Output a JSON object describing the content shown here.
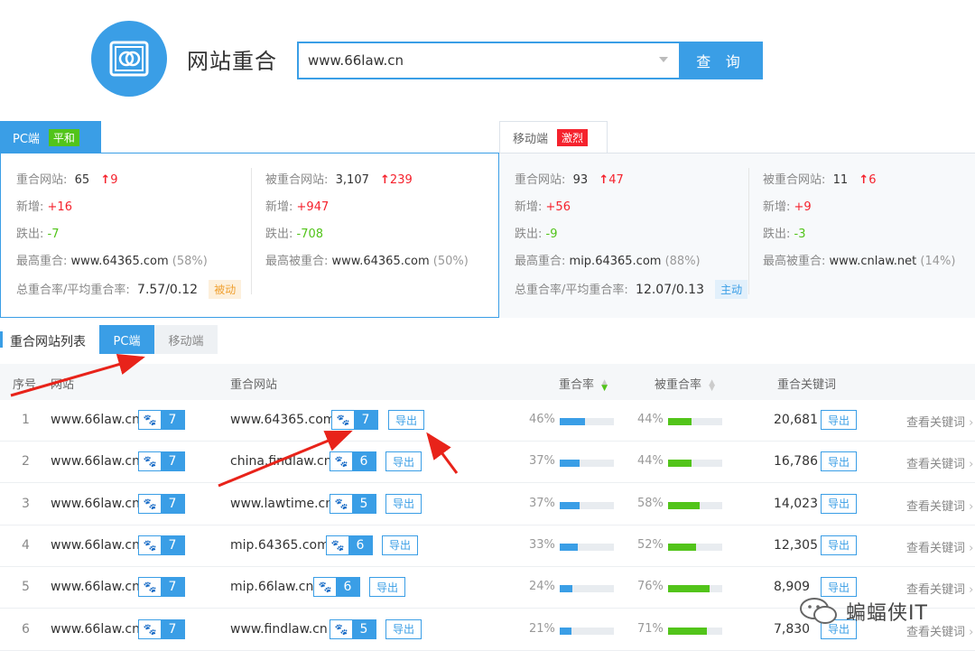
{
  "header": {
    "title": "网站重合",
    "search_value": "www.66law.cn",
    "search_button": "查 询"
  },
  "pc": {
    "tab_label": "PC端",
    "badge": "平和",
    "overlap_sites_label": "重合网站:",
    "overlap_sites": "65",
    "overlap_sites_change": "9",
    "overlapped_label": "被重合网站:",
    "overlapped": "3,107",
    "overlapped_change": "239",
    "new_label": "新增:",
    "new_left": "+16",
    "new_right": "+947",
    "drop_label": "跌出:",
    "drop_left": "-7",
    "drop_right": "-708",
    "top_overlap_label": "最高重合:",
    "top_overlap": "www.64365.com",
    "top_overlap_pct": "(58%)",
    "top_overlapped_label": "最高被重合:",
    "top_overlapped": "www.64365.com",
    "top_overlapped_pct": "(50%)",
    "rate_label": "总重合率/平均重合率:",
    "rate": "7.57/0.12",
    "rate_tag": "被动"
  },
  "mobile": {
    "tab_label": "移动端",
    "badge": "激烈",
    "overlap_sites_label": "重合网站:",
    "overlap_sites": "93",
    "overlap_sites_change": "47",
    "overlapped_label": "被重合网站:",
    "overlapped": "11",
    "overlapped_change": "6",
    "new_label": "新增:",
    "new_left": "+56",
    "new_right": "+9",
    "drop_label": "跌出:",
    "drop_left": "-9",
    "drop_right": "-3",
    "top_overlap_label": "最高重合:",
    "top_overlap": "mip.64365.com",
    "top_overlap_pct": "(88%)",
    "top_overlapped_label": "最高被重合:",
    "top_overlapped": "www.cnlaw.net",
    "top_overlapped_pct": "(14%)",
    "rate_label": "总重合率/平均重合率:",
    "rate": "12.07/0.13",
    "rate_tag": "主动"
  },
  "list": {
    "title": "重合网站列表",
    "tab_pc": "PC端",
    "tab_mobile": "移动端",
    "columns": {
      "index": "序号",
      "site": "网站",
      "overlap_site": "重合网站",
      "overlap_rate": "重合率",
      "overlapped_rate": "被重合率",
      "keywords": "重合关键词"
    },
    "export_label": "导出",
    "view_keywords_label": "查看关键词",
    "rows": [
      {
        "index": "1",
        "site": "www.66law.cn",
        "site_weight": "7",
        "overlap_site": "www.64365.com",
        "overlap_weight": "7",
        "rate": "46%",
        "rate_value": 46,
        "brate": "44%",
        "brate_value": 44,
        "keywords": "20,681"
      },
      {
        "index": "2",
        "site": "www.66law.cn",
        "site_weight": "7",
        "overlap_site": "china.findlaw.cn",
        "overlap_weight": "6",
        "rate": "37%",
        "rate_value": 37,
        "brate": "44%",
        "brate_value": 44,
        "keywords": "16,786"
      },
      {
        "index": "3",
        "site": "www.66law.cn",
        "site_weight": "7",
        "overlap_site": "www.lawtime.cn",
        "overlap_weight": "5",
        "rate": "37%",
        "rate_value": 37,
        "brate": "58%",
        "brate_value": 58,
        "keywords": "14,023"
      },
      {
        "index": "4",
        "site": "www.66law.cn",
        "site_weight": "7",
        "overlap_site": "mip.64365.com",
        "overlap_weight": "6",
        "rate": "33%",
        "rate_value": 33,
        "brate": "52%",
        "brate_value": 52,
        "keywords": "12,305"
      },
      {
        "index": "5",
        "site": "www.66law.cn",
        "site_weight": "7",
        "overlap_site": "mip.66law.cn",
        "overlap_weight": "6",
        "rate": "24%",
        "rate_value": 24,
        "brate": "76%",
        "brate_value": 76,
        "keywords": "8,909"
      },
      {
        "index": "6",
        "site": "www.66law.cn",
        "site_weight": "7",
        "overlap_site": "www.findlaw.cn",
        "overlap_weight": "5",
        "rate": "21%",
        "rate_value": 21,
        "brate": "71%",
        "brate_value": 71,
        "keywords": "7,830"
      }
    ]
  },
  "watermark": {
    "text": "蝙蝠侠IT"
  },
  "colors": {
    "accent": "#3a9ee6",
    "up": "#f5222d",
    "down": "#52c41a"
  }
}
